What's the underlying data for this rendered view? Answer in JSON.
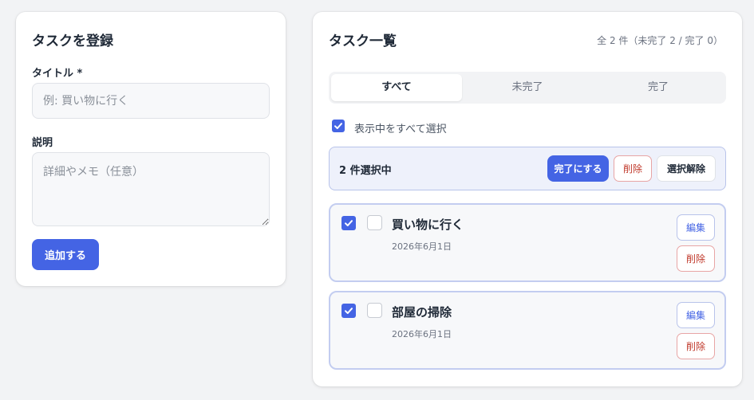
{
  "form": {
    "title": "タスクを登録",
    "title_label": "タイトル *",
    "title_placeholder": "例: 買い物に行く",
    "description_label": "説明",
    "description_placeholder": "詳細やメモ（任意）",
    "add_button": "追加する"
  },
  "list": {
    "title": "タスク一覧",
    "summary": "全 2 件（未完了 2 / 完了 0）",
    "tabs": [
      {
        "label": "すべて",
        "active": true
      },
      {
        "label": "未完了",
        "active": false
      },
      {
        "label": "完了",
        "active": false
      }
    ],
    "select_all_label": "表示中をすべて選択",
    "select_all_checked": true,
    "bulk": {
      "count_text": "2 件選択中",
      "complete_button": "完了にする",
      "delete_button": "削除",
      "clear_button": "選択解除"
    },
    "tasks": [
      {
        "title": "買い物に行く",
        "date": "2026年6月1日",
        "selected": true,
        "done": false,
        "edit_label": "編集",
        "delete_label": "削除"
      },
      {
        "title": "部屋の掃除",
        "date": "2026年6月1日",
        "selected": true,
        "done": false,
        "edit_label": "編集",
        "delete_label": "削除"
      }
    ]
  },
  "colors": {
    "accent": "#4464e4",
    "danger": "#c0392b",
    "background": "#f2f3f5"
  }
}
